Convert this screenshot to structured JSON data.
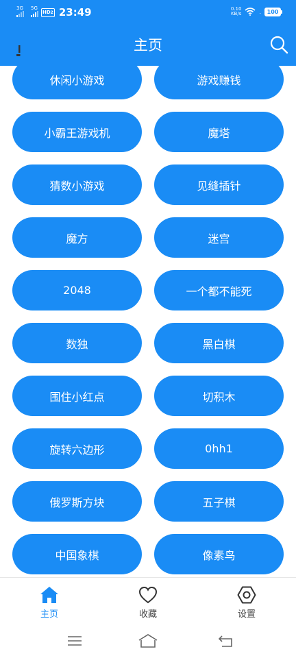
{
  "status_bar": {
    "sim1_label": "3G",
    "sim2_label": "5G",
    "hd_badge": "HD",
    "hd_sub": "2",
    "time": "23:49",
    "net_speed_value": "0.10",
    "net_speed_unit": "KB/s",
    "battery": "100"
  },
  "app_bar": {
    "title": "主页",
    "left_icon": "exclamation-mark-icon",
    "search_icon": "search-icon"
  },
  "games": [
    {
      "label": "休闲小游戏"
    },
    {
      "label": "游戏赚钱"
    },
    {
      "label": "小霸王游戏机"
    },
    {
      "label": "魔塔"
    },
    {
      "label": "猜数小游戏"
    },
    {
      "label": "见缝插针"
    },
    {
      "label": "魔方"
    },
    {
      "label": "迷宫"
    },
    {
      "label": "2048"
    },
    {
      "label": "一个都不能死"
    },
    {
      "label": "数独"
    },
    {
      "label": "黑白棋"
    },
    {
      "label": "围住小红点"
    },
    {
      "label": "切积木"
    },
    {
      "label": "旋转六边形"
    },
    {
      "label": "0hh1"
    },
    {
      "label": "俄罗斯方块"
    },
    {
      "label": "五子棋"
    },
    {
      "label": "中国象棋"
    },
    {
      "label": "像素鸟"
    }
  ],
  "bottom_nav": {
    "active": "home",
    "items": [
      {
        "label": "主页",
        "icon": "home-icon"
      },
      {
        "label": "收藏",
        "icon": "heart-icon"
      },
      {
        "label": "设置",
        "icon": "settings-hexagon-icon"
      }
    ]
  },
  "colors": {
    "primary": "#1a8cf5",
    "inactive_text": "#444444"
  }
}
